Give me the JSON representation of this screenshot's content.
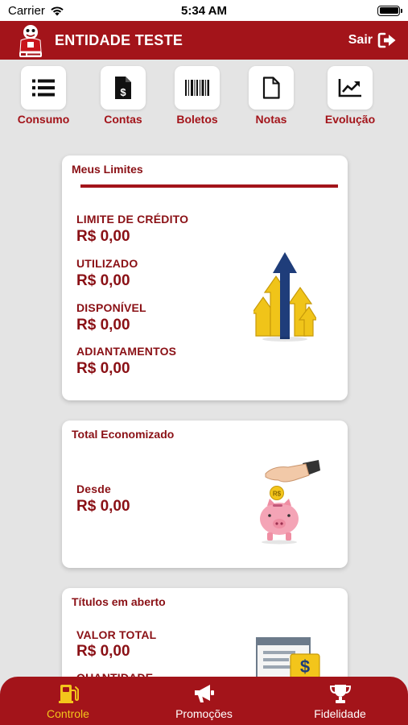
{
  "status": {
    "carrier": "Carrier",
    "time": "5:34 AM"
  },
  "header": {
    "title": "ENTIDADE TESTE",
    "logout_label": "Sair"
  },
  "menu": [
    {
      "label": "Consumo",
      "icon": "list-icon"
    },
    {
      "label": "Contas",
      "icon": "dollar-document-icon"
    },
    {
      "label": "Boletos",
      "icon": "barcode-icon"
    },
    {
      "label": "Notas",
      "icon": "document-icon"
    },
    {
      "label": "Evolução",
      "icon": "chart-line-icon"
    }
  ],
  "limits": {
    "title": "Meus Limites",
    "items": [
      {
        "label": "LIMITE DE CRÉDITO",
        "value": "R$ 0,00"
      },
      {
        "label": "UTILIZADO",
        "value": "R$ 0,00"
      },
      {
        "label": "DISPONÍVEL",
        "value": "R$ 0,00"
      },
      {
        "label": "ADIANTAMENTOS",
        "value": "R$ 0,00"
      }
    ]
  },
  "savings": {
    "title": "Total Economizado",
    "label": "Desde",
    "value": "R$ 0,00",
    "coin_text": "R$"
  },
  "titles": {
    "title": "Títulos em aberto",
    "items": [
      {
        "label": "VALOR TOTAL",
        "value": "R$ 0,00"
      },
      {
        "label": "QUANTIDADE",
        "value": ""
      }
    ]
  },
  "tabs": [
    {
      "label": "Controle",
      "active": true,
      "icon": "fuel-pump-icon"
    },
    {
      "label": "Promoções",
      "active": false,
      "icon": "megaphone-icon"
    },
    {
      "label": "Fidelidade",
      "active": false,
      "icon": "trophy-icon"
    }
  ],
  "colors": {
    "primary": "#a3141a",
    "accent": "#f3c51b",
    "background": "#e4e4e4"
  }
}
